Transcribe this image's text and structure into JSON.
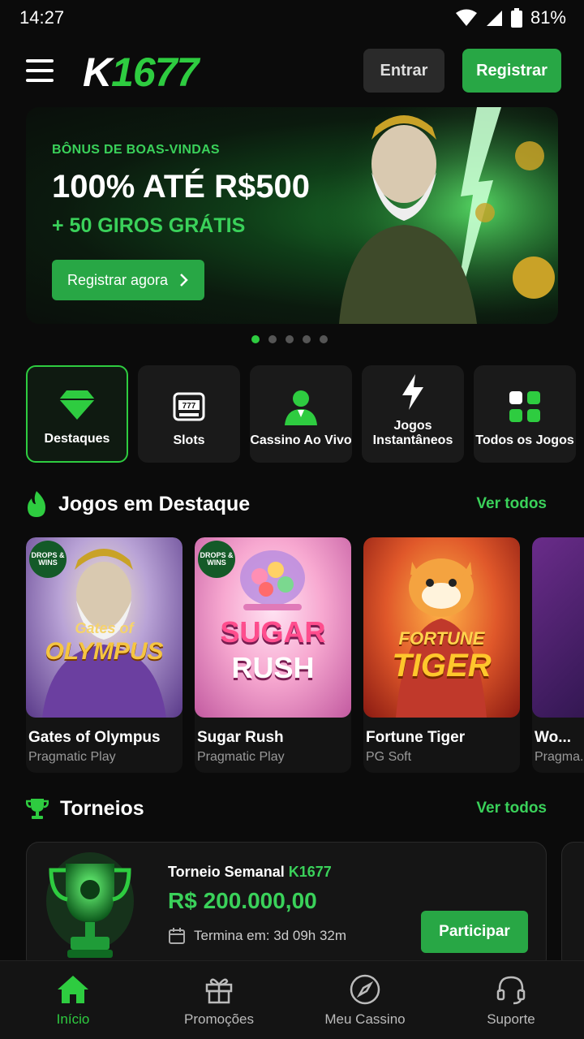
{
  "status_bar": {
    "time": "14:27",
    "battery": "81%"
  },
  "header": {
    "logo_k": "K",
    "logo_num": "1677",
    "login_label": "Entrar",
    "register_label": "Registrar"
  },
  "banner": {
    "subtitle": "BÔNUS DE BOAS-VINDAS",
    "title": "100% ATÉ R$500",
    "extra": "+ 50 GIROS GRÁTIS",
    "cta_label": "Registrar agora",
    "slides_total": 5,
    "active_slide": 1
  },
  "categories": [
    {
      "label": "Destaques",
      "icon": "diamond-icon",
      "active": true
    },
    {
      "label": "Slots",
      "icon": "slot-machine-icon",
      "active": false
    },
    {
      "label": "Cassino Ao Vivo",
      "icon": "dealer-icon",
      "active": false
    },
    {
      "label": "Jogos Instantâneos",
      "icon": "lightning-icon",
      "active": false
    },
    {
      "label": "Todos os Jogos",
      "icon": "grid-icon",
      "active": false
    }
  ],
  "featured": {
    "title": "Jogos em Destaque",
    "see_all": "Ver todos",
    "games": [
      {
        "name": "Gates of Olympus",
        "provider": "Pragmatic Play",
        "art_line1": "Gates of",
        "art_line2": "OLYMPUS",
        "badge": "DROPS & WINS"
      },
      {
        "name": "Sugar Rush",
        "provider": "Pragmatic Play",
        "art_line1": "SUGAR",
        "art_line2": "RUSH",
        "badge": "DROPS & WINS"
      },
      {
        "name": "Fortune Tiger",
        "provider": "PG Soft",
        "art_line1": "FORTUNE",
        "art_line2": "TIGER"
      },
      {
        "name": "Wo...",
        "provider": "Pragma..."
      }
    ]
  },
  "tournaments": {
    "title": "Torneios",
    "see_all": "Ver todos",
    "card": {
      "name_prefix": "Torneio Semanal ",
      "name_brand": "K1677",
      "prize": "R$ 200.000,00",
      "ends_label": "Termina em: 3d 09h 32m",
      "join_label": "Participar"
    }
  },
  "bottom_nav": [
    {
      "label": "Início",
      "icon": "home-icon",
      "active": true
    },
    {
      "label": "Promoções",
      "icon": "gift-icon",
      "active": false
    },
    {
      "label": "Meu Cassino",
      "icon": "compass-icon",
      "active": false
    },
    {
      "label": "Suporte",
      "icon": "headset-icon",
      "active": false
    }
  ],
  "colors": {
    "accent": "#2ecc40",
    "button": "#28a745",
    "background": "#0b0b0b"
  }
}
